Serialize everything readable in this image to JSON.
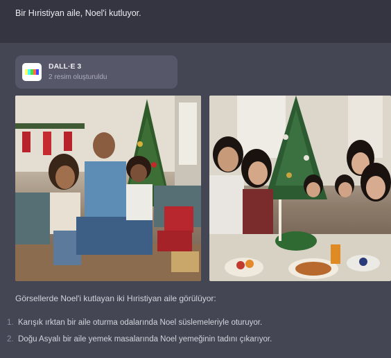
{
  "user_message": "Bir Hıristiyan aile, Noel'i kutluyor.",
  "tool": {
    "name": "DALL·E 3",
    "status": "2 resim oluşturuldu",
    "icon": "dalle-icon",
    "stripe_colors": [
      "#ffff66",
      "#42ffff",
      "#51da4c",
      "#ff6e3c",
      "#3c46ff"
    ]
  },
  "images": [
    {
      "alt": "family-living-room-christmas-image"
    },
    {
      "alt": "family-dinner-christmas-image"
    }
  ],
  "response": {
    "intro": "Görsellerde Noel'i kutlayan iki Hıristiyan aile görülüyor:",
    "items": [
      {
        "number": "1.",
        "text": "Karışık ırktan bir aile oturma odalarında Noel süslemeleriyle oturuyor."
      },
      {
        "number": "2.",
        "text": "Doğu Asyalı bir aile yemek masalarında Noel yemeğinin tadını çıkarıyor."
      }
    ]
  },
  "colors": {
    "background": "#343541",
    "assistant_background": "#444654",
    "card": "#565869"
  }
}
